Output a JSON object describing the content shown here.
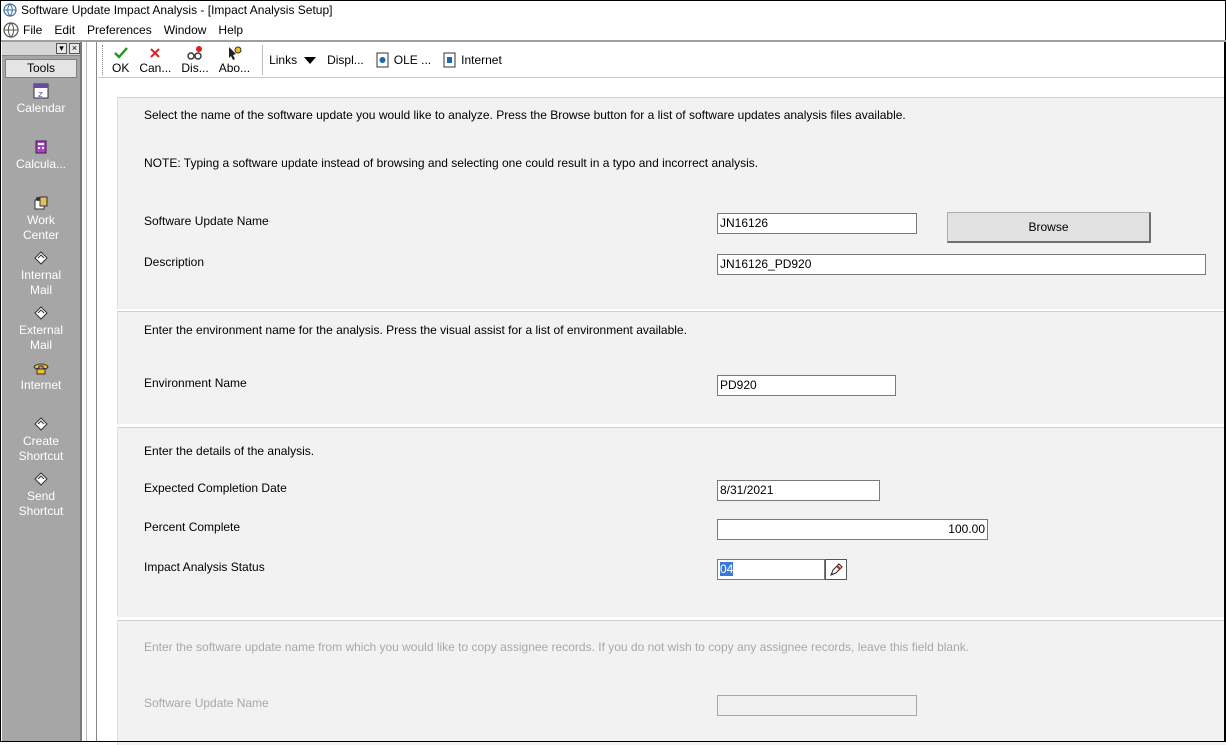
{
  "window": {
    "title": "Software Update Impact Analysis - [Impact Analysis Setup]"
  },
  "menu": {
    "items": [
      "File",
      "Edit",
      "Preferences",
      "Window",
      "Help"
    ]
  },
  "tools_pane": {
    "header": "Tools",
    "items": [
      {
        "line1": "Calendar",
        "line2": "",
        "icon": "calendar-icon"
      },
      {
        "line1": "Calcula...",
        "line2": "",
        "icon": "calculator-icon"
      },
      {
        "line1": "Work",
        "line2": "Center",
        "icon": "work-center-icon"
      },
      {
        "line1": "Internal",
        "line2": "Mail",
        "icon": "internal-mail-icon"
      },
      {
        "line1": "External",
        "line2": "Mail",
        "icon": "external-mail-icon"
      },
      {
        "line1": "Internet",
        "line2": "",
        "icon": "internet-icon"
      },
      {
        "line1": "Create",
        "line2": "Shortcut",
        "icon": "create-shortcut-icon"
      },
      {
        "line1": "Send",
        "line2": "Shortcut",
        "icon": "send-shortcut-icon"
      }
    ]
  },
  "toolbar": {
    "ok": "OK",
    "cancel": "Can...",
    "display": "Dis...",
    "about": "Abo...",
    "links": "Links",
    "displ": "Displ...",
    "ole": "OLE ...",
    "internet": "Internet"
  },
  "section1": {
    "instruction": "Select the name of the software update you would like to analyze. Press the Browse button for a list of software updates analysis files available.",
    "note": "NOTE: Typing a software update instead of browsing and selecting one could result in a typo and incorrect analysis.",
    "name_label": "Software Update Name",
    "name_value": "JN16126",
    "browse_label": "Browse",
    "desc_label": "Description",
    "desc_value": "JN16126_PD920"
  },
  "section2": {
    "instruction": "Enter the environment name for the analysis. Press the visual assist for a list of environment available.",
    "env_label": "Environment Name",
    "env_value": "PD920"
  },
  "section3": {
    "instruction": "Enter the details of the analysis.",
    "date_label": "Expected Completion Date",
    "date_value": "8/31/2021",
    "percent_label": "Percent Complete",
    "percent_value": "100.00",
    "status_label": "Impact Analysis Status",
    "status_value": "04"
  },
  "section4": {
    "instruction": "Enter the software update name from which you would like to copy assignee records. If you do not wish to copy any assignee records, leave this field blank.",
    "name_label": "Software Update Name",
    "name_value": ""
  },
  "colors": {
    "tools_bg": "#a6a6a6",
    "section_bg": "#f2f2f2",
    "selection": "#3b78d8"
  }
}
